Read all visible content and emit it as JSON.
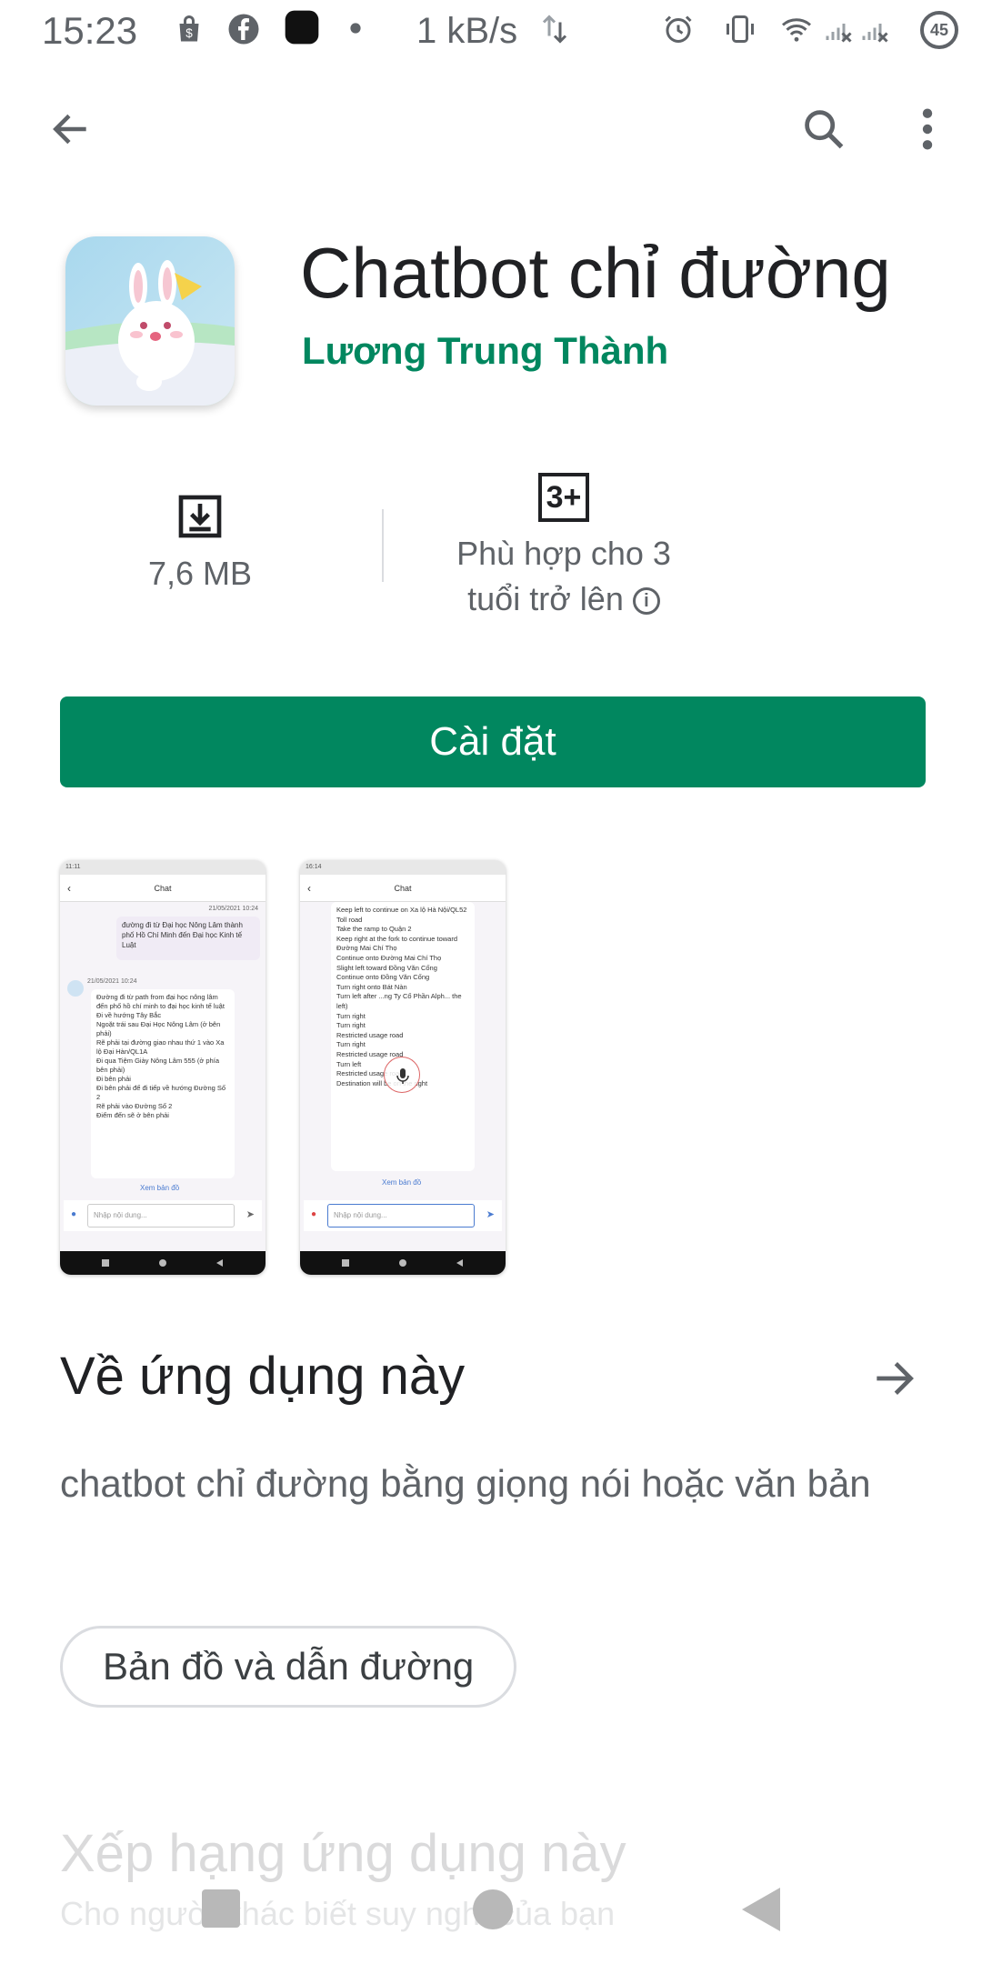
{
  "status_bar": {
    "time": "15:23",
    "net_speed": "1 kB/s",
    "battery": "45"
  },
  "app": {
    "title": "Chatbot chỉ đường",
    "developer": "Lương Trung Thành",
    "size": "7,6 MB",
    "rating_badge": "3+",
    "rating_line1": "Phù hợp cho 3",
    "rating_line2": "tuổi trở lên",
    "install_label": "Cài đặt"
  },
  "screenshots": [
    {
      "status": "11:11",
      "title": "Chat",
      "user_date": "21/05/2021 10:24",
      "user_msg": "đường đi từ Đại học Nông Lâm thành phố Hồ Chí Minh đến Đại học Kinh tế Luật",
      "bot_date": "21/05/2021 10:24",
      "bot_msg": "Đường đi từ path from đại học nông lâm đến phố hồ chí minh to đại học kinh tế luật\nĐi về hướng Tây Bắc\nNgoặt trái sau Đại Học Nông Lâm (ở bên phải)\nRẽ phải tại đường giao nhau thứ 1 vào Xa lộ Đại Hàn/QL1A\nĐi qua Tiệm Giày Nông Lâm 555 (ở phía bên phải)\nĐi bên phải\nĐi bên phải để đi tiếp về hướng Đường Số 2\nRẽ phải vào Đường Số 2\nĐiểm đến sẽ ở bên phải",
      "map_link": "Xem bản đồ",
      "input_placeholder": "Nhập nội dung..."
    },
    {
      "status": "16:14",
      "title": "Chat",
      "bot_msg": "Keep left to continue on Xa lộ Hà Nội/QL52\nToll road\nTake the ramp to Quận 2\nKeep right at the fork to continue toward Đường Mai Chí Thọ\nContinue onto Đường Mai Chí Thọ\nSlight left toward Đồng Văn Cống\nContinue onto Đồng Văn Cống\nTurn right onto Bát Nàn\nTurn left after ...ng Ty Cổ Phần Alph... the left)\nTurn right\nTurn right\nRestricted usage road\nTurn right\nRestricted usage road\nTurn left\nRestricted usage road\nDestination will be on the right",
      "map_link": "Xem bản đồ",
      "input_placeholder": "Nhập nội dung..."
    }
  ],
  "about": {
    "title": "Về ứng dụng này",
    "description": "chatbot chỉ đường bằng giọng nói hoặc văn bản",
    "category_chip": "Bản đồ và dẫn đường"
  },
  "rate": {
    "title": "Xếp hạng ứng dụng này",
    "subtitle": "Cho người khác biết suy nghĩ của bạn"
  },
  "colors": {
    "accent": "#01875f",
    "text_primary": "#202124",
    "text_secondary": "#5f6368"
  }
}
